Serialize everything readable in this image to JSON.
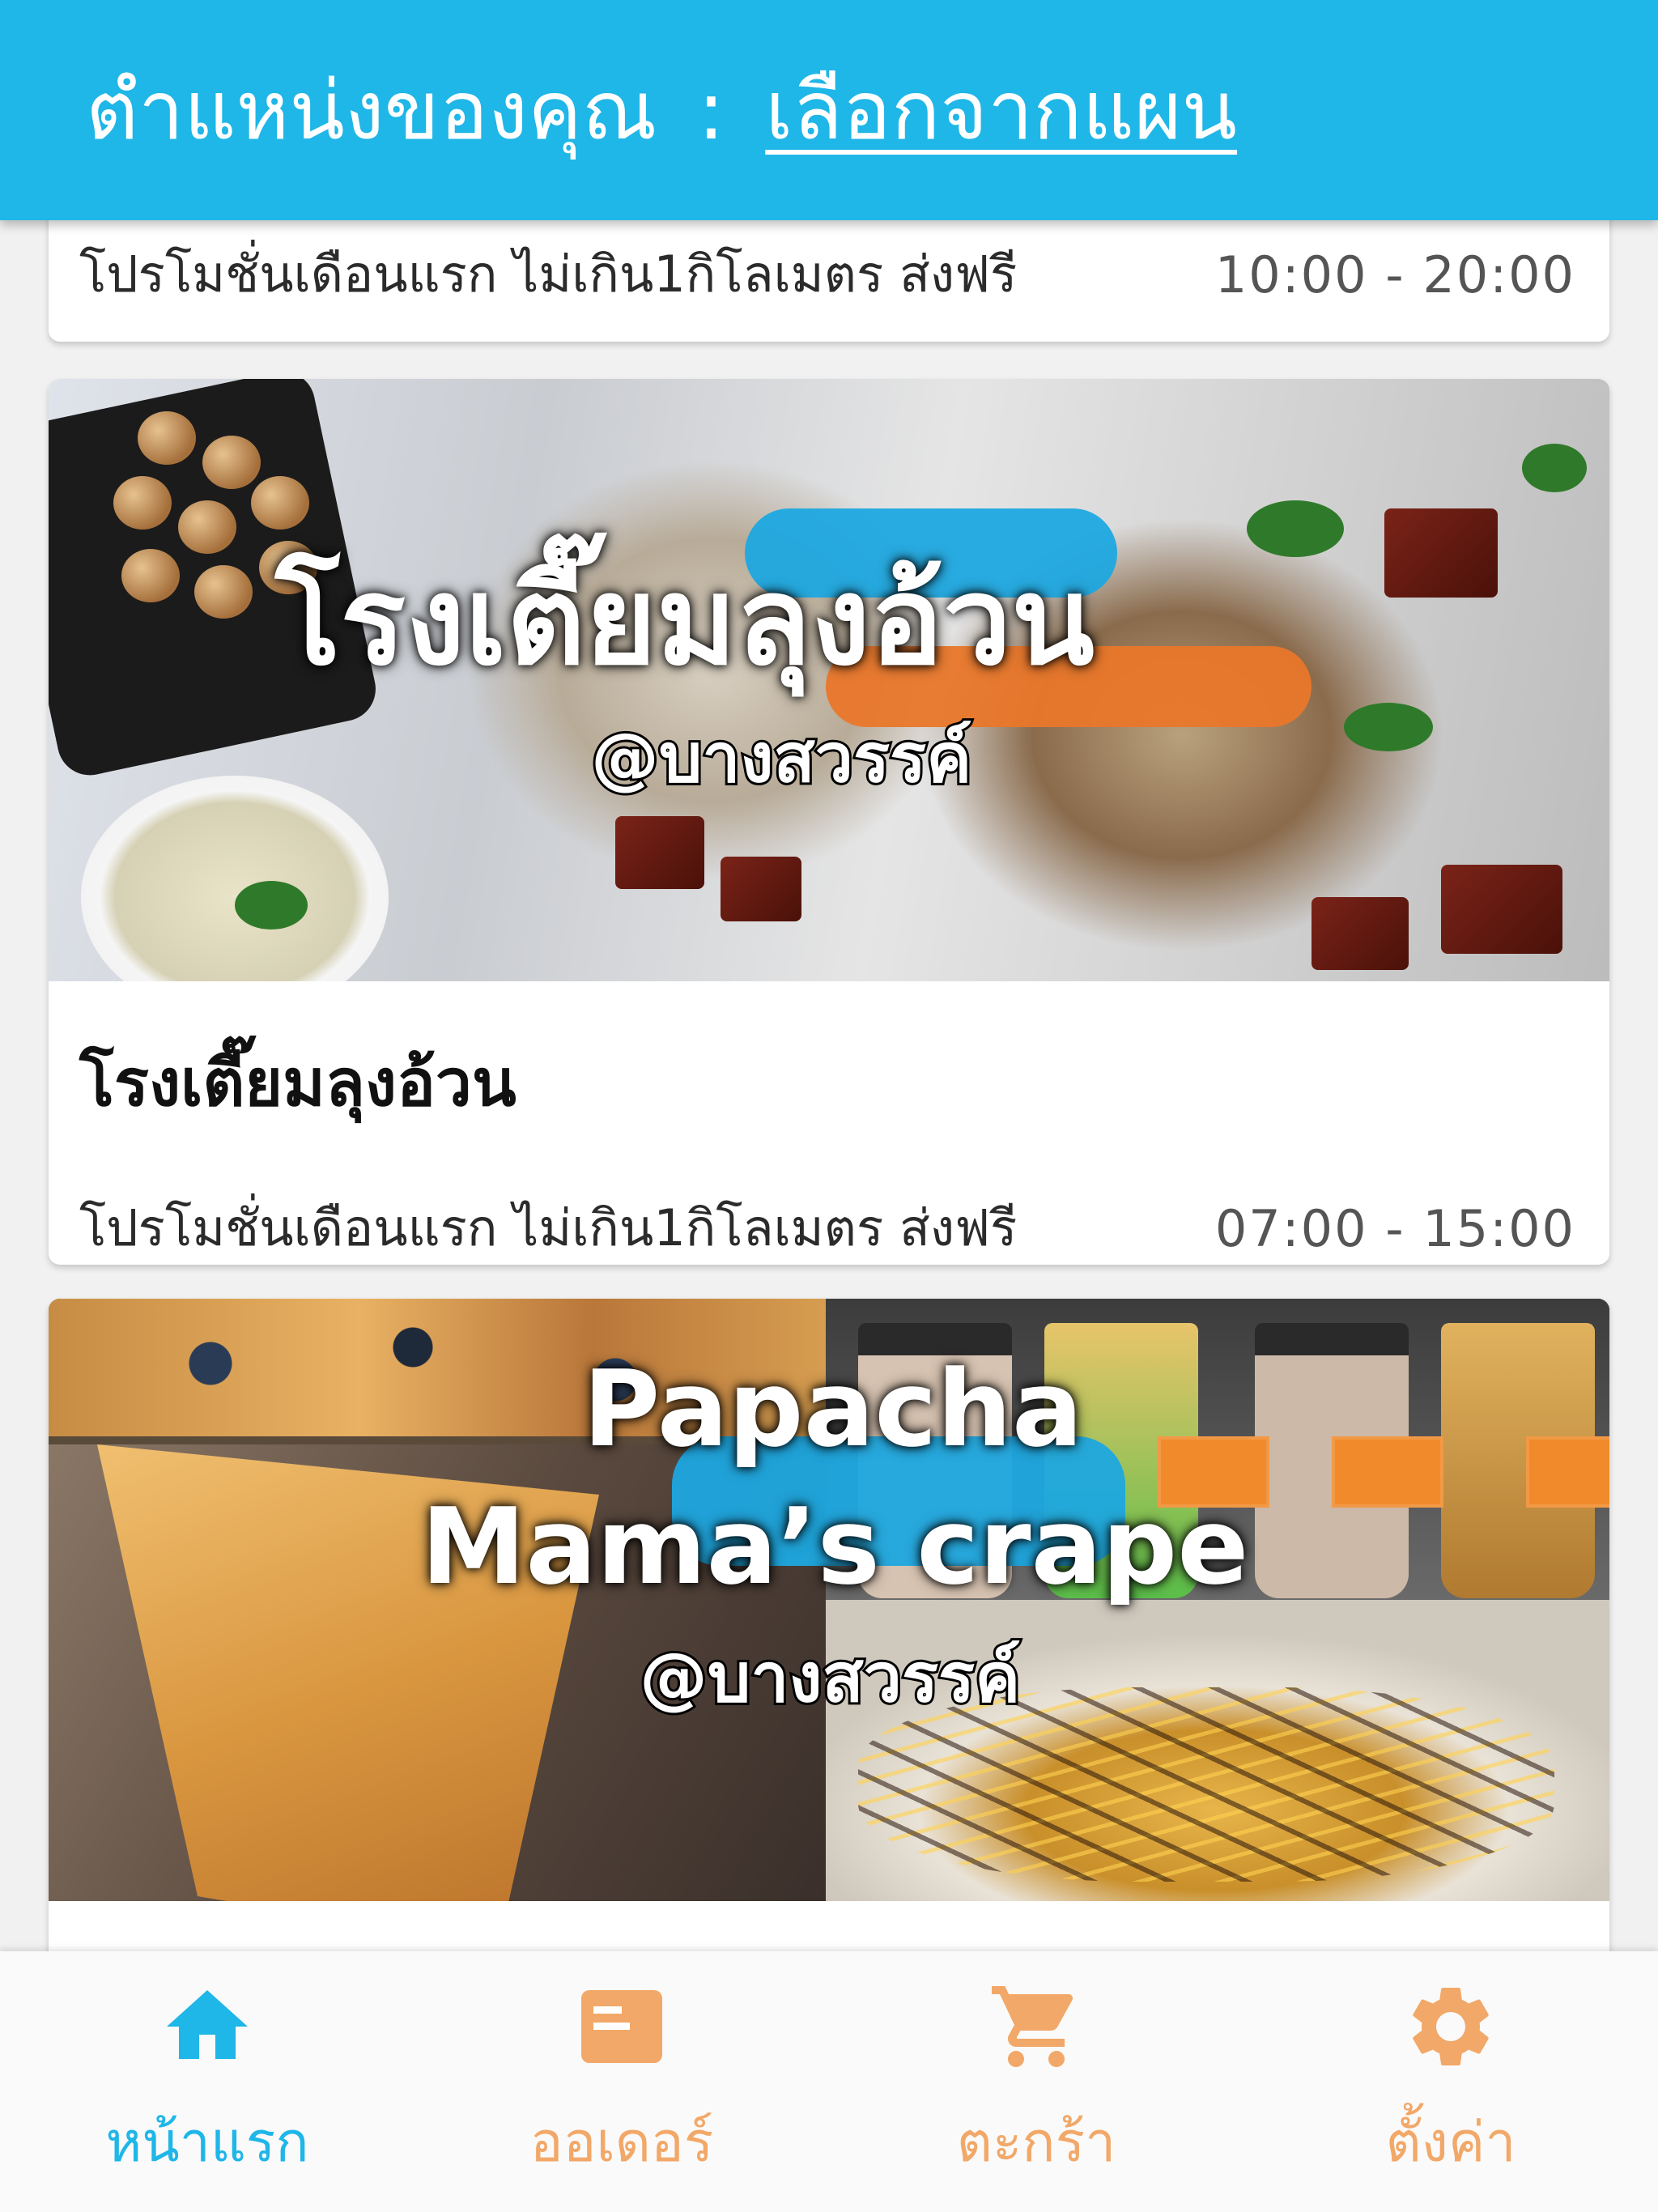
{
  "header": {
    "location_label": "ตำแหน่งของคุณ",
    "separator": ":",
    "pick_link": "เลือกจากแผน"
  },
  "cards": [
    {
      "name": "",
      "promo": "โปรโมชั่นเดือนแรก ไม่เกิน1กิโลเมตร ส่งฟรี",
      "hours": "10:00 - 20:00"
    },
    {
      "banner_title": "โรงเตี๊ยมลุงอ้วน",
      "banner_subtitle": "@บางสวรรค์",
      "name": "โรงเตี๊ยมลุงอ้วน",
      "promo": "โปรโมชั่นเดือนแรก ไม่เกิน1กิโลเมตร ส่งฟรี",
      "hours": "07:00 - 15:00"
    },
    {
      "banner_title_line1": "Papacha",
      "banner_title_line2": "Mama’s crape",
      "banner_subtitle": "@บางสวรรค์"
    }
  ],
  "bottom_nav": {
    "items": [
      {
        "label": "หน้าแรก",
        "icon": "home-icon",
        "active": true
      },
      {
        "label": "ออเดอร์",
        "icon": "order-icon",
        "active": false
      },
      {
        "label": "ตะกร้า",
        "icon": "cart-icon",
        "active": false
      },
      {
        "label": "ตั้งค่า",
        "icon": "gear-icon",
        "active": false
      }
    ]
  },
  "colors": {
    "accent": "#1fb6e8",
    "inactive_nav": "#f2a868",
    "background": "#f1f1f1"
  }
}
